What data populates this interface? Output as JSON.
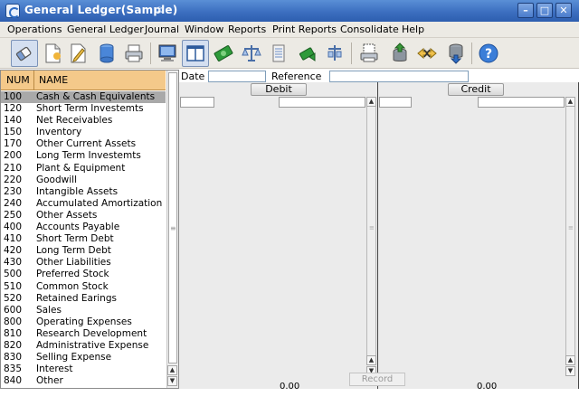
{
  "window": {
    "title": "General Ledger(Sample)",
    "title_color": "#3c6fc0",
    "controls": [
      "minimize-icon",
      "maximize-icon",
      "close-icon"
    ]
  },
  "menu": [
    {
      "label": "Operations"
    },
    {
      "label": "General Ledger"
    },
    {
      "label": "Journal"
    },
    {
      "label": "Window"
    },
    {
      "label": "Reports"
    },
    {
      "label": "Print Reports"
    },
    {
      "label": "Consolidate"
    },
    {
      "label": "Help"
    }
  ],
  "toolbar": {
    "icons": [
      "eraser-icon",
      "new-document-icon",
      "edit-document-icon",
      "database-icon",
      "print-icon",
      "computer-icon",
      "split-view-icon",
      "money-icon",
      "scale-icon",
      "ledger-sheet-icon",
      "money-transfer-icon",
      "report-scale-icon",
      "copy-print-icon",
      "upload-database-icon",
      "exchange-icon",
      "download-database-icon",
      "help-icon"
    ],
    "accent": "#2d6cc4"
  },
  "accounts": {
    "headers": {
      "num": "NUM",
      "name": "NAME"
    },
    "header_color": "#f4c98a",
    "rows": [
      {
        "num": "100",
        "name": "Cash & Cash Equivalents",
        "selected": true
      },
      {
        "num": "120",
        "name": "Short Term Investemts"
      },
      {
        "num": "140",
        "name": "Net Receivables"
      },
      {
        "num": "150",
        "name": "Inventory"
      },
      {
        "num": "170",
        "name": "Other Current Assets"
      },
      {
        "num": "200",
        "name": "Long Term Investemts"
      },
      {
        "num": "210",
        "name": "Plant & Equipment"
      },
      {
        "num": "220",
        "name": "Goodwill"
      },
      {
        "num": "230",
        "name": "Intangible Assets"
      },
      {
        "num": "240",
        "name": "Accumulated Amortization"
      },
      {
        "num": "250",
        "name": "Other Assets"
      },
      {
        "num": "400",
        "name": "Accounts Payable"
      },
      {
        "num": "410",
        "name": "Short Term Debt"
      },
      {
        "num": "420",
        "name": "Long Term Debt"
      },
      {
        "num": "430",
        "name": "Other Liabilities"
      },
      {
        "num": "500",
        "name": "Preferred Stock"
      },
      {
        "num": "510",
        "name": "Common Stock"
      },
      {
        "num": "520",
        "name": "Retained Earings"
      },
      {
        "num": "600",
        "name": "Sales"
      },
      {
        "num": "800",
        "name": "Operating Expenses"
      },
      {
        "num": "810",
        "name": "Research Development"
      },
      {
        "num": "820",
        "name": "Administrative Expense"
      },
      {
        "num": "830",
        "name": "Selling Expense"
      },
      {
        "num": "835",
        "name": "Interest"
      },
      {
        "num": "840",
        "name": "Other"
      }
    ]
  },
  "journal": {
    "date_label": "Date",
    "date_value": "",
    "reference_label": "Reference",
    "reference_value": "",
    "debit_label": "Debit",
    "credit_label": "Credit",
    "debit_total": "0.00",
    "credit_total": "0.00",
    "record_label": "Record"
  }
}
